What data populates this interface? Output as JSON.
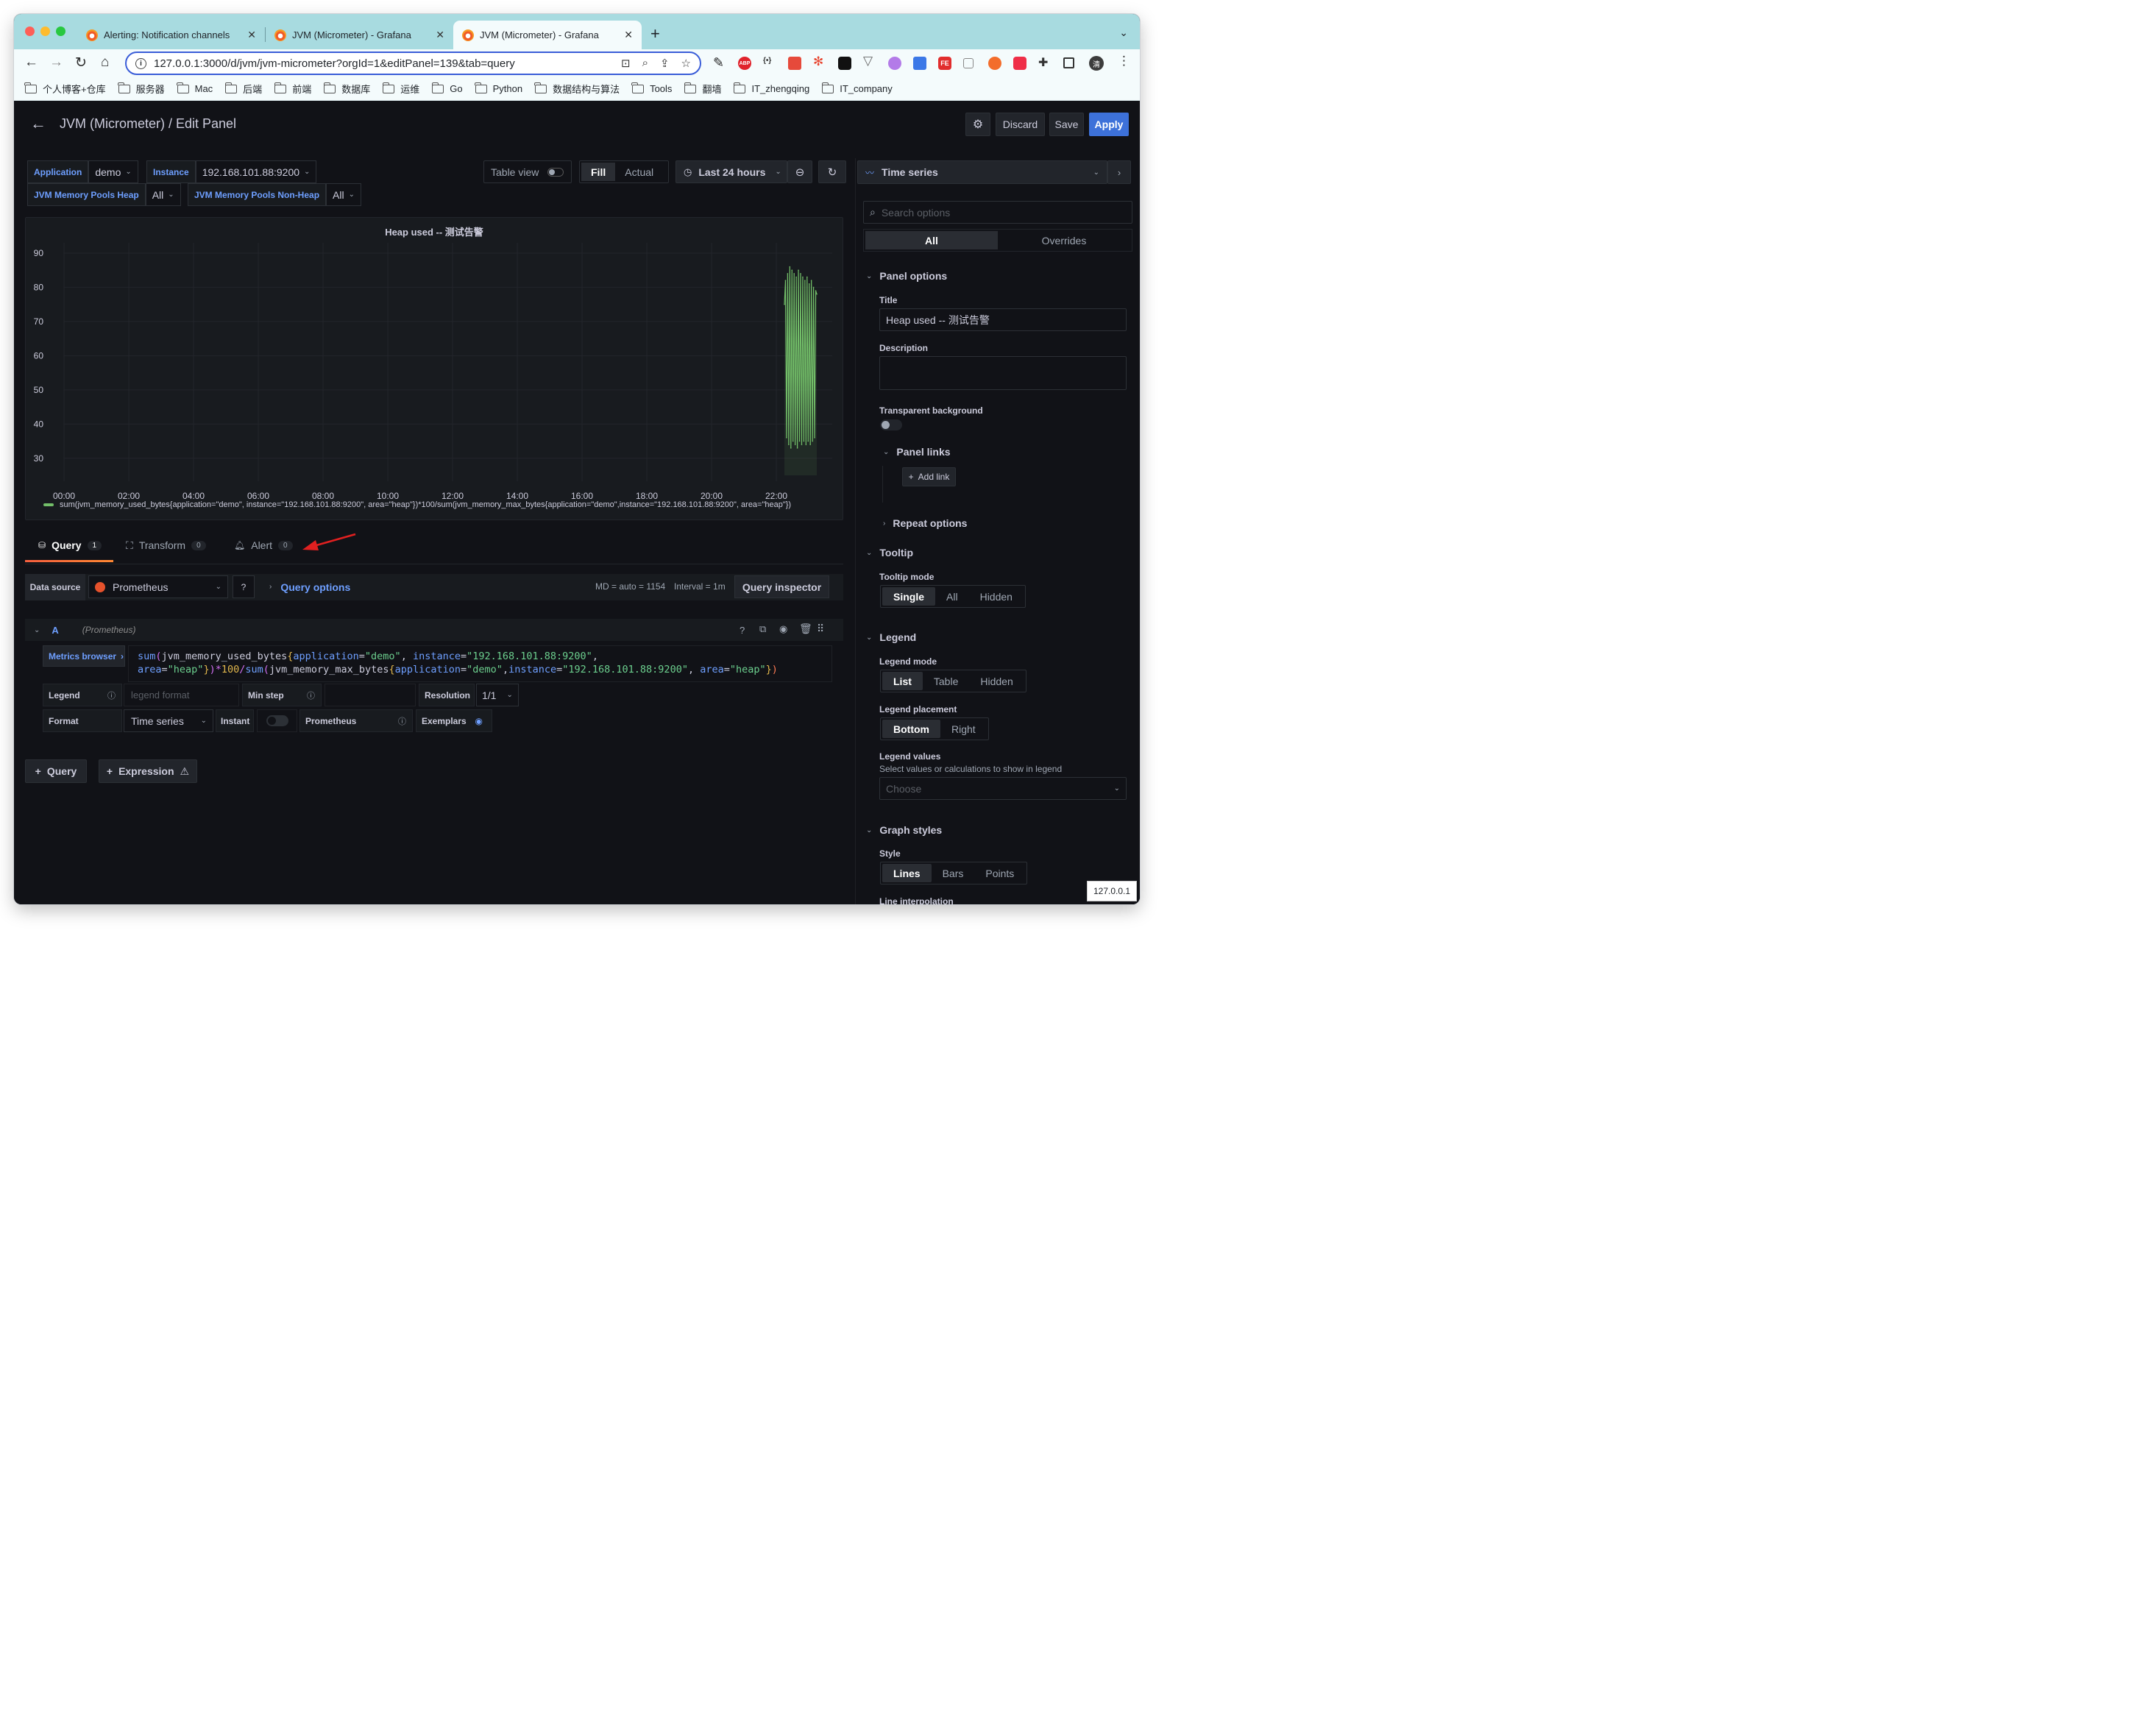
{
  "browser": {
    "tabs": [
      {
        "title": "Alerting: Notification channels"
      },
      {
        "title": "JVM (Micrometer) - Grafana"
      },
      {
        "title": "JVM (Micrometer) - Grafana"
      }
    ],
    "url": "127.0.0.1:3000/d/jvm/jvm-micrometer?orgId=1&editPanel=139&tab=query",
    "bookmarks": [
      "个人博客+仓库",
      "服务器",
      "Mac",
      "后端",
      "前端",
      "数据库",
      "运维",
      "Go",
      "Python",
      "数据结构与算法",
      "Tools",
      "翻墙",
      "IT_zhengqing",
      "IT_company"
    ],
    "extensions": {
      "abp": "ABP",
      "json": "{•}",
      "fe": "FE",
      "avatar": "清"
    },
    "status_tooltip": "127.0.0.1"
  },
  "header": {
    "title": "JVM (Micrometer) / Edit Panel",
    "discard": "Discard",
    "save": "Save",
    "apply": "Apply"
  },
  "variables": [
    {
      "label": "Application",
      "value": "demo"
    },
    {
      "label": "Instance",
      "value": "192.168.101.88:9200"
    },
    {
      "label": "JVM Memory Pools Heap",
      "value": "All"
    },
    {
      "label": "JVM Memory Pools Non-Heap",
      "value": "All"
    }
  ],
  "controls": {
    "table_view": "Table view",
    "fill": "Fill",
    "actual": "Actual",
    "time_range": "Last 24 hours",
    "viz_type": "Time series"
  },
  "panel": {
    "title": "Heap used -- 测试告警",
    "legend": "sum(jvm_memory_used_bytes{application=\"demo\", instance=\"192.168.101.88:9200\", area=\"heap\"})*100/sum(jvm_memory_max_bytes{application=\"demo\",instance=\"192.168.101.88:9200\", area=\"heap\"})"
  },
  "chart_data": {
    "type": "line",
    "title": "Heap used -- 测试告警",
    "xlabel": "",
    "ylabel": "",
    "y_ticks": [
      30,
      40,
      50,
      60,
      70,
      80,
      90
    ],
    "x_ticks": [
      "00:00",
      "02:00",
      "04:00",
      "06:00",
      "08:00",
      "10:00",
      "12:00",
      "14:00",
      "16:00",
      "18:00",
      "20:00",
      "22:00"
    ],
    "ylim": [
      25,
      93
    ],
    "grid": true,
    "legend_position": "bottom",
    "series": [
      {
        "color": "#73bf69",
        "x": [
          "22:15",
          "22:17",
          "22:19",
          "22:21",
          "22:23",
          "22:25",
          "22:27",
          "22:29",
          "22:31",
          "22:33",
          "22:35",
          "22:37",
          "22:39",
          "22:41",
          "22:43",
          "22:45",
          "22:47",
          "22:49",
          "22:51",
          "22:53",
          "22:55",
          "22:57",
          "22:59",
          "23:01",
          "23:03",
          "23:05",
          "23:07",
          "23:09",
          "23:11",
          "23:13",
          "23:15"
        ],
        "values": [
          75,
          82,
          36,
          84,
          34,
          86,
          33,
          85,
          35,
          84,
          34,
          83,
          33,
          85,
          35,
          84,
          34,
          83,
          35,
          82,
          34,
          83,
          35,
          81,
          34,
          82,
          35,
          80,
          36,
          79,
          78
        ]
      }
    ]
  },
  "query_tabs": [
    {
      "label": "Query",
      "count": "1"
    },
    {
      "label": "Transform",
      "count": "0"
    },
    {
      "label": "Alert",
      "count": "0"
    }
  ],
  "query_editor": {
    "data_source_label": "Data source",
    "data_source": "Prometheus",
    "query_options": "Query options",
    "md_info": "MD = auto = 1154",
    "interval_info": "Interval = 1m",
    "inspector": "Query inspector",
    "ref_id": "A",
    "ref_ds": "(Prometheus)",
    "metrics_browser": "Metrics browser",
    "legend_label": "Legend",
    "legend_placeholder": "legend format",
    "min_step_label": "Min step",
    "resolution_label": "Resolution",
    "resolution_value": "1/1",
    "format_label": "Format",
    "format_value": "Time series",
    "instant_label": "Instant",
    "prometheus_label": "Prometheus",
    "exemplars_label": "Exemplars",
    "add_query": "Query",
    "add_expression": "Expression"
  },
  "options": {
    "search_placeholder": "Search options",
    "tab_all": "All",
    "tab_overrides": "Overrides",
    "panel_options": "Panel options",
    "title_label": "Title",
    "title_value": "Heap used -- 测试告警",
    "description_label": "Description",
    "transparent_label": "Transparent background",
    "panel_links": "Panel links",
    "add_link": "Add link",
    "repeat_options": "Repeat options",
    "tooltip": "Tooltip",
    "tooltip_mode_label": "Tooltip mode",
    "tooltip_modes": [
      "Single",
      "All",
      "Hidden"
    ],
    "legend": "Legend",
    "legend_mode_label": "Legend mode",
    "legend_modes": [
      "List",
      "Table",
      "Hidden"
    ],
    "legend_placement_label": "Legend placement",
    "legend_placements": [
      "Bottom",
      "Right"
    ],
    "legend_values_label": "Legend values",
    "legend_values_desc": "Select values or calculations to show in legend",
    "legend_values_placeholder": "Choose",
    "graph_styles": "Graph styles",
    "style_label": "Style",
    "styles": [
      "Lines",
      "Bars",
      "Points"
    ],
    "line_interpolation_label": "Line interpolation"
  },
  "colors": {
    "accent": "#3d71d9",
    "series": "#73bf69",
    "query_tab_underline": "#f55f3e",
    "annotation_arrow": "#e02020"
  }
}
